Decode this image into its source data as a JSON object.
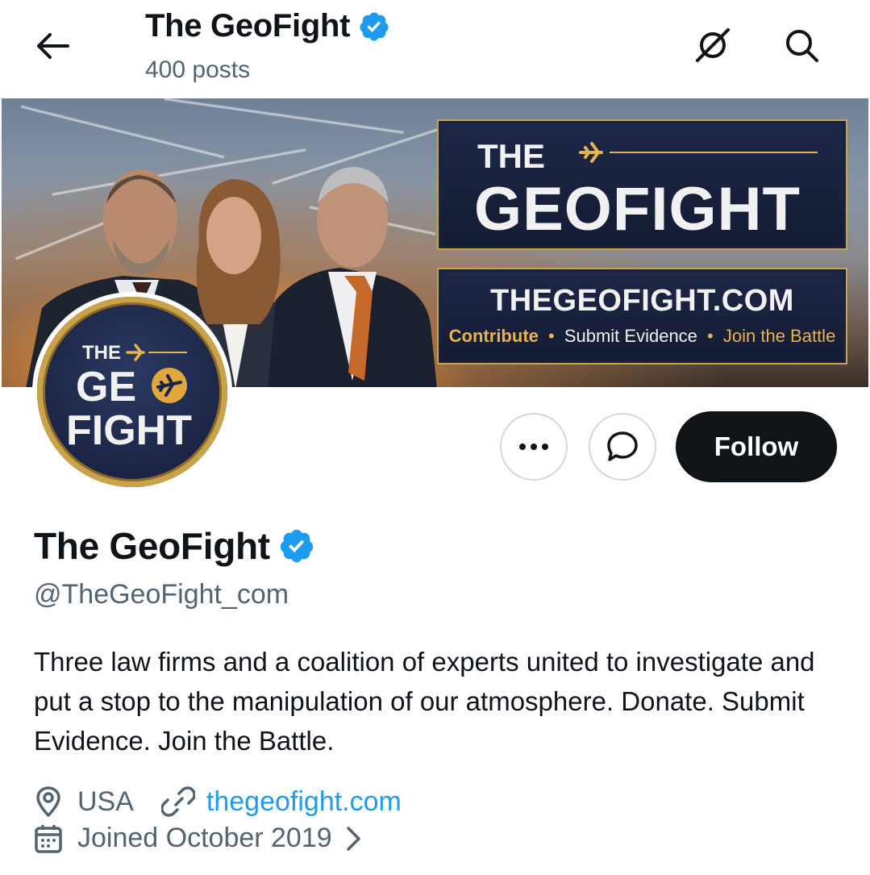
{
  "header": {
    "title": "The GeoFight",
    "post_count": "400 posts"
  },
  "banner": {
    "logo_line1": "THE",
    "logo_line2": "GEOFIGHT",
    "website": "THEGEOFIGHT.COM",
    "tagline_1": "Contribute",
    "tagline_2": "Submit Evidence",
    "tagline_3": "Join the Battle",
    "separator": "•"
  },
  "avatar": {
    "line1": "THE",
    "line2": "GE",
    "line3": "FIGHT"
  },
  "actions": {
    "follow_label": "Follow"
  },
  "profile": {
    "name": "The GeoFight",
    "handle": "@TheGeoFight_com",
    "bio": "Three law firms and a coalition of experts united to investigate and put a stop to the manipulation of our atmosphere. Donate. Submit Evidence. Join the Battle.",
    "location": "USA",
    "website": "thegeofight.com",
    "joined": "Joined October 2019"
  },
  "colors": {
    "verified": "#1d9bf0",
    "link": "#1d9bf0",
    "muted": "#536471",
    "gold": "#c9a24a",
    "navy": "#1b2444"
  },
  "icons": [
    "back-arrow-icon",
    "verified-badge-icon",
    "no-notifications-icon",
    "search-icon",
    "more-icon",
    "message-icon",
    "location-icon",
    "link-icon",
    "calendar-icon",
    "chevron-right-icon"
  ]
}
